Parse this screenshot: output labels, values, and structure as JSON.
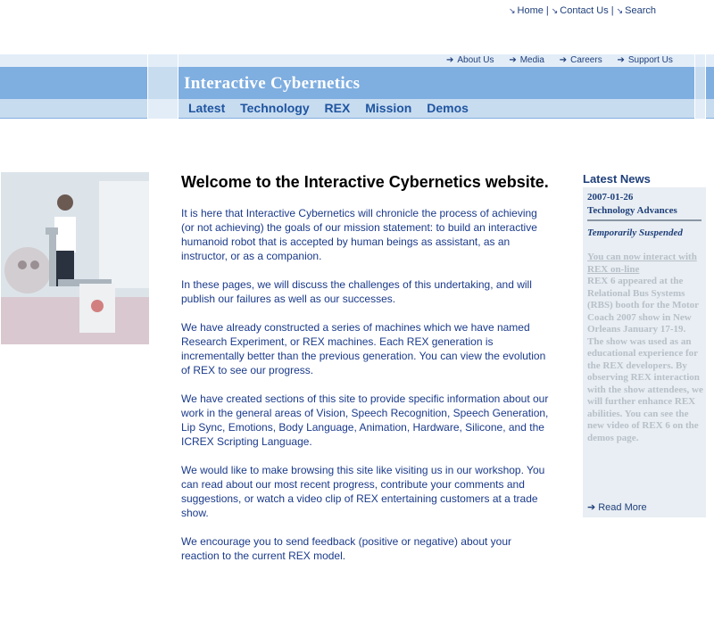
{
  "util_links": {
    "home": "Home",
    "contact": "Contact Us",
    "search": "Search",
    "separator": "|"
  },
  "sub_links": {
    "about": "About Us",
    "media": "Media",
    "careers": "Careers",
    "support": "Support Us"
  },
  "site_title": "Interactive Cybernetics",
  "main_nav": {
    "latest": "Latest",
    "technology": "Technology",
    "rex": "REX",
    "mission": "Mission",
    "demos": "Demos"
  },
  "content": {
    "heading": "Welcome to the Interactive Cybernetics website.",
    "paragraphs": [
      "It is here that Interactive Cybernetics will chronicle the process of achieving (or not achieving) the goals of our mission statement: to build an interactive humanoid robot that is accepted by human beings as assistant, as an instructor, or as a companion.",
      "In these pages, we will discuss the challenges of this undertaking, and will publish our failures as well as our successes.",
      "We have already constructed a series of machines which we have named Research Experiment, or REX machines. Each REX generation is incrementally better than the previous generation. You can view the evolution of REX to see our progress.",
      "We have created sections of this site to provide specific information about our work in the general areas of Vision, Speech Recognition, Speech Generation, Lip Sync, Emotions, Body Language, Animation, Hardware, Silicone, and the ICREX Scripting Language.",
      "We would like to make browsing this site like visiting us in our workshop. You can read about our most recent progress, contribute your comments and suggestions, or watch a video clip of REX entertaining customers at a trade show.",
      "We encourage you to send feedback (positive or negative) about your reaction to the current REX model."
    ]
  },
  "news": {
    "title": "Latest News",
    "date": "2007-01-26",
    "category": "Technology Advances",
    "headline": "Temporarily Suspended",
    "link_text": "You can now interact with REX on-line",
    "body": "REX 6 appeared at the Relational Bus Systems (RBS) booth for the Motor Coach 2007 show in New Orleans January 17-19. The show was used as an educational experience for the REX developers. By observing REX interaction with the show attendees, we will further enhance REX abilities. You can see the new video of REX 6 on the demos page.",
    "read_more": "Read More"
  },
  "icons": {
    "util_arrow": "corner-arrow-icon",
    "link_arrow": "right-arrow-icon"
  },
  "colors": {
    "header_blue": "#7faee0",
    "nav_band": "#c8dcf0",
    "light_band": "#e2edf8",
    "link_blue": "#1f55a0",
    "text_blue": "#1a3a8a",
    "news_bg": "#e8eef3"
  }
}
